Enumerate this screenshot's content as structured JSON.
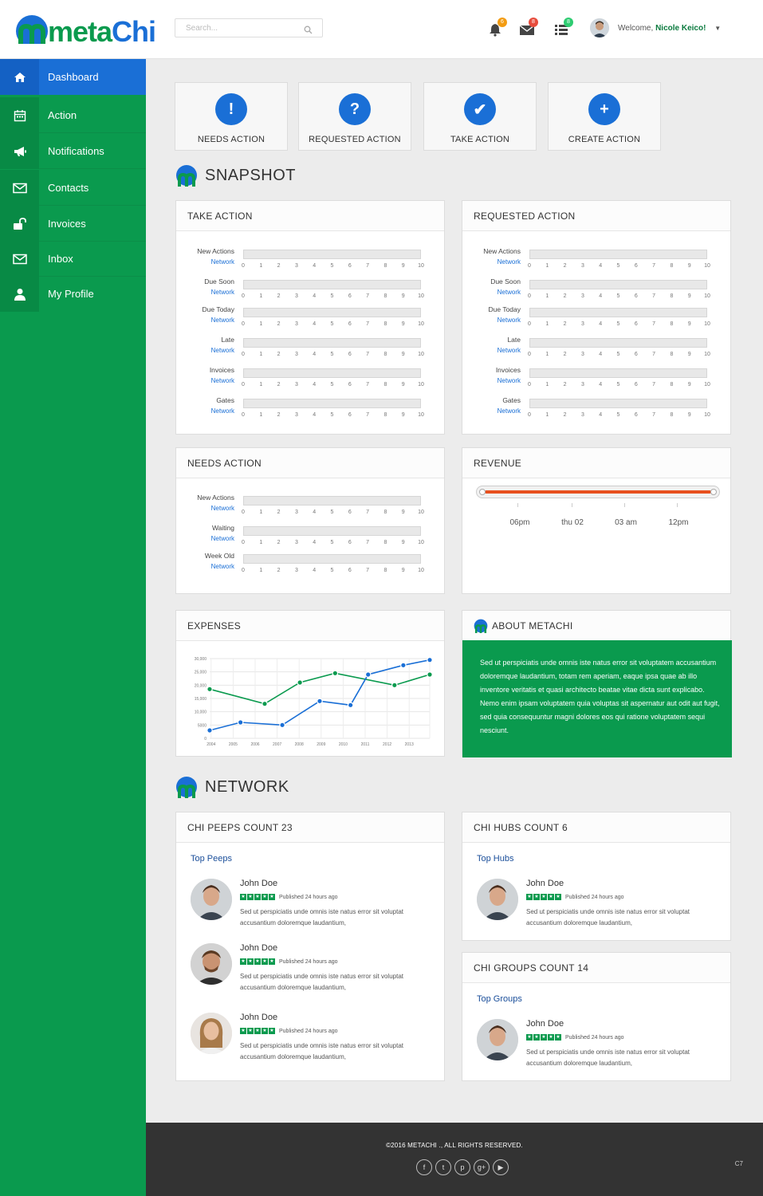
{
  "app": {
    "logo_prefix": "meta",
    "logo_suffix": "Chi"
  },
  "header": {
    "search_placeholder": "Search...",
    "notifications": [
      {
        "icon": "bell-icon",
        "count": "6",
        "color": "#f39c12"
      },
      {
        "icon": "mail-icon",
        "count": "8",
        "color": "#e74c3c"
      },
      {
        "icon": "tasks-icon",
        "count": "8",
        "color": "#2ecc71"
      }
    ],
    "welcome_prefix": "Welcome,",
    "user_name": "Nicole Keico!"
  },
  "sidebar": {
    "items": [
      {
        "label": "Dashboard",
        "icon": "home-icon",
        "active": true
      },
      {
        "label": "Action",
        "icon": "calendar-icon"
      },
      {
        "label": "Notifications",
        "icon": "megaphone-icon"
      },
      {
        "label": "Contacts",
        "icon": "envelope-icon"
      },
      {
        "label": "Invoices",
        "icon": "unlock-icon"
      },
      {
        "label": "Inbox",
        "icon": "envelope-icon"
      },
      {
        "label": "My Profile",
        "icon": "user-icon"
      }
    ]
  },
  "actions": [
    {
      "label": "NEEDS ACTION",
      "symbol": "!",
      "icon": "exclamation-icon"
    },
    {
      "label": "REQUESTED ACTION",
      "symbol": "?",
      "icon": "question-icon"
    },
    {
      "label": "TAKE ACTION",
      "symbol": "✔",
      "icon": "check-icon"
    },
    {
      "label": "CREATE ACTION",
      "symbol": "+",
      "icon": "plus-icon"
    }
  ],
  "snapshot": {
    "title": "SNAPSHOT",
    "take_action": {
      "title": "TAKE ACTION",
      "rows": [
        {
          "label": "New Actions",
          "sub": "Network"
        },
        {
          "label": "Due Soon",
          "sub": "Network"
        },
        {
          "label": "Due Today",
          "sub": "Network"
        },
        {
          "label": "Late",
          "sub": "Network"
        },
        {
          "label": "Invoices",
          "sub": "Network"
        },
        {
          "label": "Gates",
          "sub": "Network"
        }
      ]
    },
    "requested_action": {
      "title": "REQUESTED ACTION",
      "rows": [
        {
          "label": "New Actions",
          "sub": "Network"
        },
        {
          "label": "Due Soon",
          "sub": "Network"
        },
        {
          "label": "Due Today",
          "sub": "Network"
        },
        {
          "label": "Late",
          "sub": "Network"
        },
        {
          "label": "Invoices",
          "sub": "Network"
        },
        {
          "label": "Gates",
          "sub": "Network"
        }
      ]
    },
    "needs_action": {
      "title": "NEEDS ACTION",
      "rows": [
        {
          "label": "New Actions",
          "sub": "Network"
        },
        {
          "label": "Waiting",
          "sub": "Network"
        },
        {
          "label": "Week Old",
          "sub": "Network"
        }
      ]
    },
    "tick_labels": [
      "0",
      "1",
      "2",
      "3",
      "4",
      "5",
      "6",
      "7",
      "8",
      "9",
      "10"
    ],
    "revenue": {
      "title": "REVENUE",
      "labels": [
        "06pm",
        "thu 02",
        "03 am",
        "12pm"
      ]
    },
    "expenses": {
      "title": "EXPENSES"
    },
    "about": {
      "title": "ABOUT METACHI",
      "text": "Sed ut perspiciatis unde omnis iste natus error sit voluptatem accusantium doloremque laudantium, totam rem aperiam, eaque ipsa quae ab illo inventore veritatis et quasi architecto beatae vitae dicta sunt explicabo. Nemo enim ipsam voluptatem quia voluptas sit aspernatur aut odit aut fugit, sed quia consequuntur magni dolores eos qui ratione voluptatem sequi nesciunt."
    }
  },
  "chart_data": {
    "type": "line",
    "title": "EXPENSES",
    "xlabel": "",
    "ylabel": "",
    "x": [
      "2004",
      "2005",
      "2006",
      "2007",
      "2008",
      "2009",
      "2010",
      "2011",
      "2012",
      "2013"
    ],
    "ytick_labels": [
      "0",
      "5000",
      "10,000",
      "15,000",
      "20,000",
      "25,000",
      "30,000"
    ],
    "ylim": [
      0,
      30000
    ],
    "grid": true,
    "series": [
      {
        "color": "#0a9a4e",
        "points": [
          [
            2003.5,
            18500
          ],
          [
            2006,
            13000
          ],
          [
            2007.6,
            21000
          ],
          [
            2009.2,
            24500
          ],
          [
            2011.9,
            20000
          ],
          [
            2013.5,
            24000
          ]
        ]
      },
      {
        "color": "#1a6fd6",
        "points": [
          [
            2003.5,
            3000
          ],
          [
            2004.9,
            6000
          ],
          [
            2006.8,
            5000
          ],
          [
            2008.5,
            14000
          ],
          [
            2009.9,
            12500
          ],
          [
            2010.7,
            24000
          ],
          [
            2012.3,
            27500
          ],
          [
            2013.5,
            29500
          ]
        ]
      }
    ]
  },
  "network": {
    "title": "NETWORK",
    "peeps": {
      "title": "CHI PEEPS COUNT 23",
      "sub": "Top Peeps",
      "items": [
        {
          "name": "John Doe",
          "published": "Published 24 hours ago",
          "desc": "Sed ut perspiciatis unde omnis iste natus error sit voluptat accusantium doloremque laudantium,"
        },
        {
          "name": "John Doe",
          "published": "Published 24 hours ago",
          "desc": "Sed ut perspiciatis unde omnis iste natus error sit voluptat accusantium doloremque laudantium,"
        },
        {
          "name": "John Doe",
          "published": "Published 24 hours ago",
          "desc": "Sed ut perspiciatis unde omnis iste natus error sit voluptat accusantium doloremque laudantium,"
        }
      ]
    },
    "hubs": {
      "title": "CHI HUBS COUNT 6",
      "sub": "Top Hubs",
      "items": [
        {
          "name": "John Doe",
          "published": "Published 24 hours ago",
          "desc": "Sed ut perspiciatis unde omnis iste natus error sit voluptat accusantium doloremque laudantium,"
        }
      ]
    },
    "groups": {
      "title": "CHI GROUPS COUNT 14",
      "sub": "Top Groups",
      "items": [
        {
          "name": "John Doe",
          "published": "Published 24 hours ago",
          "desc": "Sed ut perspiciatis unde omnis iste natus error sit voluptat accusantium doloremque laudantium,"
        }
      ]
    }
  },
  "footer": {
    "copyright": "©2016 METACHI ., ALL RIGHTS RESERVED.",
    "social": [
      {
        "icon": "facebook-icon",
        "glyph": "f"
      },
      {
        "icon": "twitter-icon",
        "glyph": "t"
      },
      {
        "icon": "pinterest-icon",
        "glyph": "p"
      },
      {
        "icon": "googleplus-icon",
        "glyph": "g+"
      },
      {
        "icon": "youtube-icon",
        "glyph": "▶"
      }
    ],
    "version": "C7"
  }
}
